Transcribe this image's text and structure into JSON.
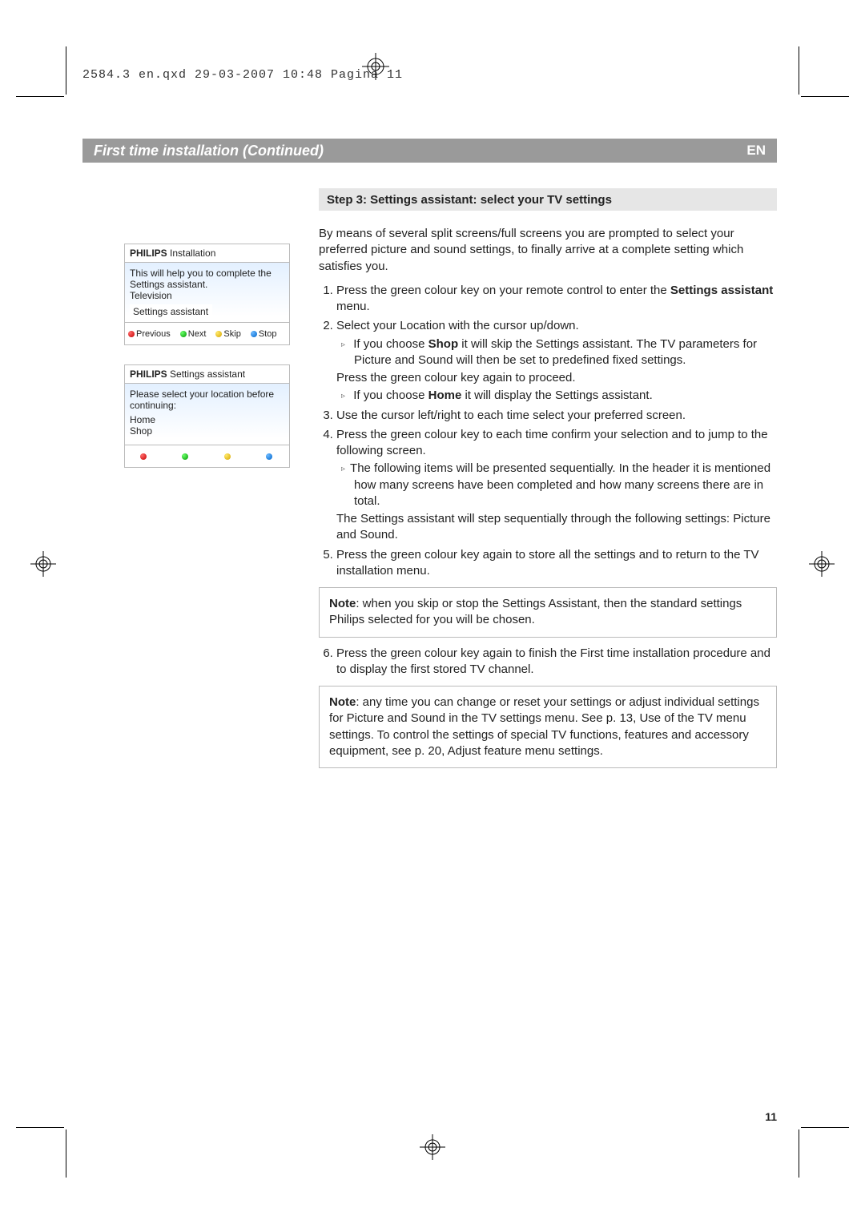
{
  "slug": "2584.3 en.qxd  29-03-2007  10:48  Pagina 11",
  "header": {
    "title": "First time installation  (Continued)",
    "lang": "EN"
  },
  "step_title": "Step 3: Settings assistant: select your TV settings",
  "menu1": {
    "brand": "PHILIPS",
    "title": "Installation",
    "lines": [
      "This will help you to complete the Settings assistant.",
      "Television"
    ],
    "selected": "Settings assistant",
    "footer": [
      {
        "color": "red",
        "label": "Previous"
      },
      {
        "color": "green",
        "label": "Next"
      },
      {
        "color": "yellow",
        "label": "Skip"
      },
      {
        "color": "blue",
        "label": "Stop"
      }
    ]
  },
  "menu2": {
    "brand": "PHILIPS",
    "title": "Settings assistant",
    "lines": [
      "Please select your location before continuing:",
      "Home",
      "Shop"
    ],
    "footer_dots": [
      "red",
      "green",
      "yellow",
      "blue"
    ]
  },
  "intro": "By means of several split screens/full screens you are prompted to select your preferred picture and sound settings, to finally arrive at a complete setting which satisfies you.",
  "steps": {
    "s1a": "Press the green colour key on your remote control to enter the ",
    "s1b_bold": "Settings assistant",
    "s1c": " menu.",
    "s2": "Select your Location with the cursor up/down.",
    "s2_sub1a": "If you choose ",
    "s2_sub1b_bold": "Shop",
    "s2_sub1c": " it will skip the Settings assistant. The TV parameters for Picture and Sound will then be set to predefined fixed settings.",
    "s2_extra": "Press the green colour key again to proceed.",
    "s2_sub2a": "If you choose ",
    "s2_sub2b_bold": "Home",
    "s2_sub2c": " it will display the Settings assistant.",
    "s3": "Use the cursor left/right to each time select your preferred screen.",
    "s4": "Press the green colour key to each time confirm your selection and to jump to the following screen.",
    "s4_sub1": "The following items will be presented sequentially. In the header it is mentioned how many screens have been completed and how many screens there are in total.",
    "s4_extra": "The Settings assistant will step sequentially through the following settings: Picture and Sound.",
    "s5": "Press the green colour key again to store all the settings and to return to the TV installation menu.",
    "s6": "Press the green colour key again to finish the First time installation procedure and to display the first stored TV channel."
  },
  "note1_label": "Note",
  "note1_text": ": when you skip or stop the Settings Assistant, then the standard settings Philips selected for you will be chosen.",
  "note2_label": "Note",
  "note2_text": ": any time you can change or reset your settings or adjust individual settings for Picture and Sound in the TV settings menu. See p. 13, Use of the TV menu settings. To control the settings of special TV functions, features and accessory equipment, see p. 20,  Adjust feature menu settings.",
  "page_number": "11"
}
